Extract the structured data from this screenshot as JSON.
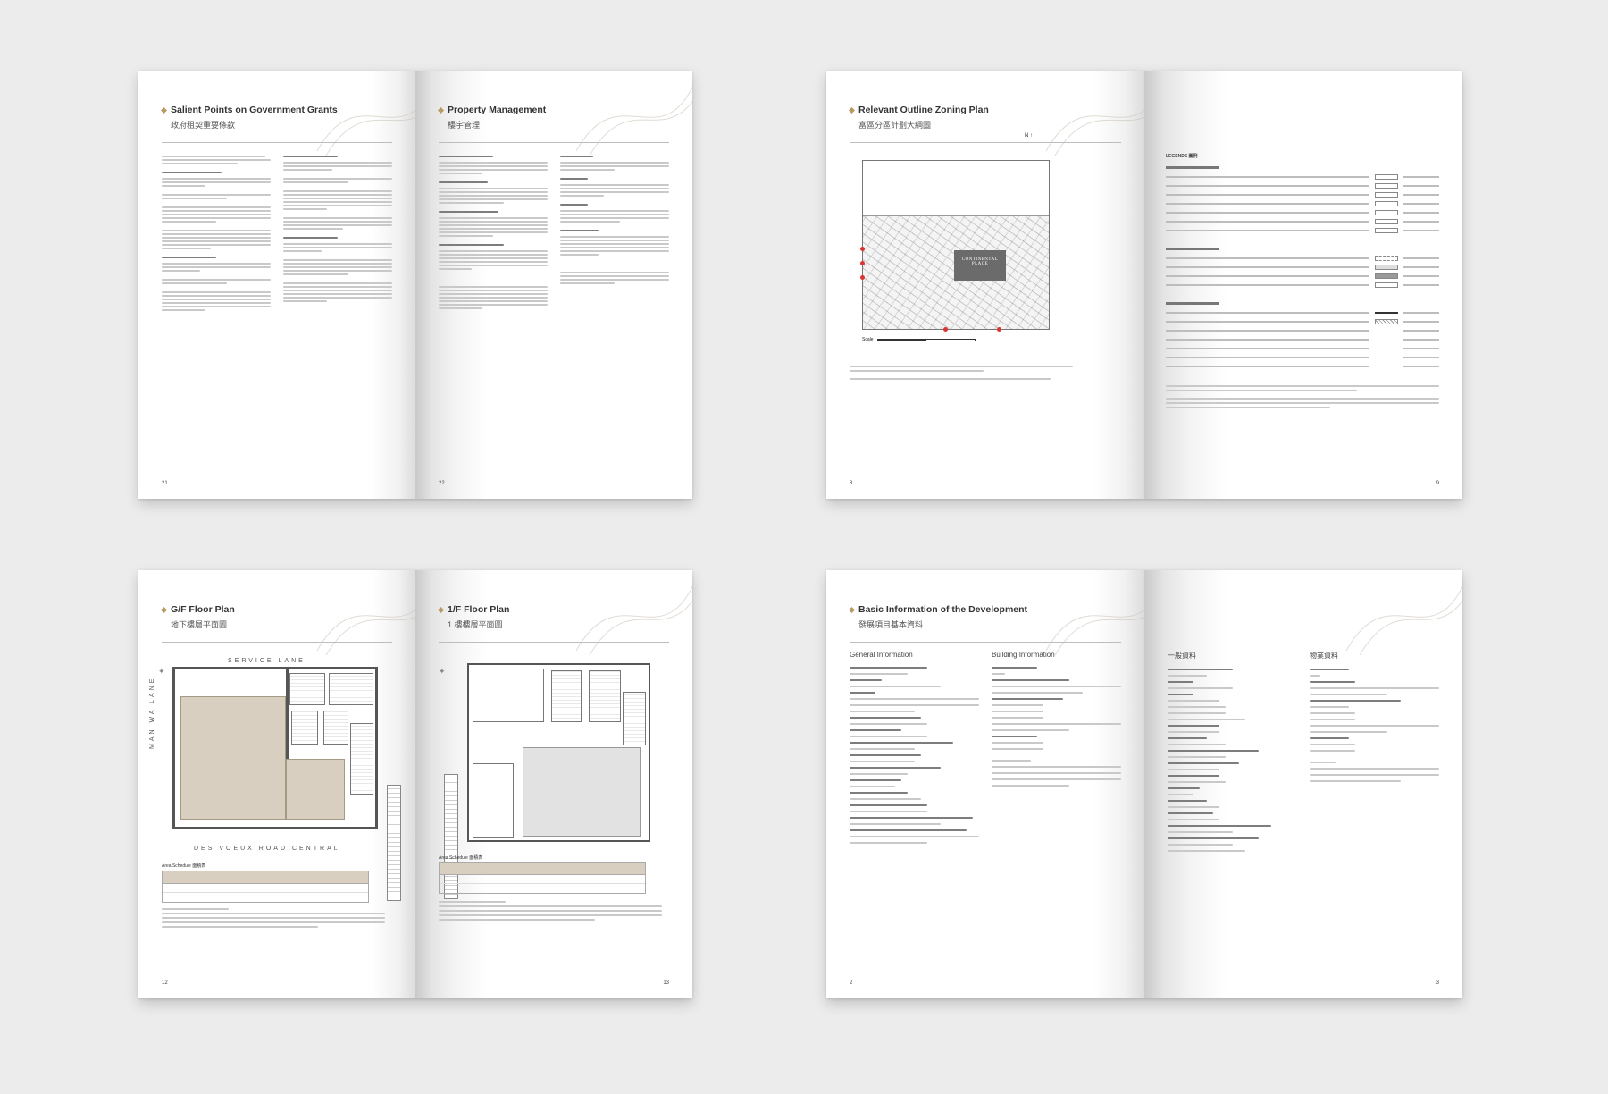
{
  "spreads": [
    {
      "left_page": {
        "title_en": "Salient Points on Government Grants",
        "title_zh": "政府租契重要條款",
        "page_number": "21"
      },
      "right_page": {
        "title_en": "Property Management",
        "title_zh": "樓宇管理",
        "page_number": "22"
      }
    },
    {
      "left_page": {
        "title_en": "Relevant Outline Zoning Plan",
        "title_zh": "富區分區計劃大綱圖",
        "page_number": "8",
        "map_label": "CONTINENTAL PLACE",
        "scale_label": "Scale"
      },
      "right_page": {
        "legend_heading": "LEGENDS 圖例",
        "page_number": "9"
      }
    },
    {
      "left_page": {
        "title_en": "G/F Floor Plan",
        "title_zh": "地下樓層平面圖",
        "page_number": "12",
        "street_top": "SERVICE LANE",
        "street_left": "MAN WA LANE",
        "street_bottom": "DES VOEUX ROAD CENTRAL",
        "schedule_title": "Area Schedule 面積表"
      },
      "right_page": {
        "title_en": "1/F Floor Plan",
        "title_zh": "1 樓樓層平面圖",
        "page_number": "13",
        "schedule_title": "Area Schedule 面積表"
      }
    },
    {
      "left_page": {
        "title_en": "Basic Information of the Development",
        "title_zh": "發展項目基本資料",
        "page_number": "2",
        "col1_heading": "General Information",
        "col2_heading": "Building Information"
      },
      "right_page": {
        "page_number": "3",
        "col1_heading": "一般資料",
        "col2_heading": "物業資料"
      }
    }
  ]
}
